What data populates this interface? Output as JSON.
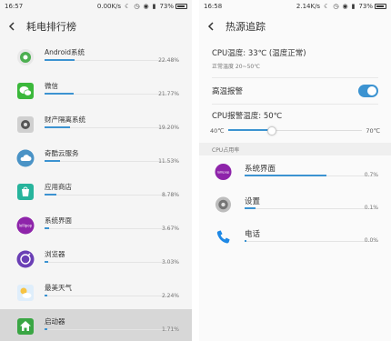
{
  "left": {
    "status": {
      "time": "16:57",
      "net": "0.00K/s",
      "battery": "73%"
    },
    "title": "耗电排行榜",
    "apps": [
      {
        "name": "Android系统",
        "pct": "22.48%",
        "level": 0.2248,
        "icon": "android-system-icon",
        "color": "#4caf50"
      },
      {
        "name": "微信",
        "pct": "21.77%",
        "level": 0.2177,
        "icon": "wechat-icon",
        "color": "#3bb83b"
      },
      {
        "name": "财产隔离系统",
        "pct": "19.20%",
        "level": 0.192,
        "icon": "safe-icon",
        "color": "#d0d0d0"
      },
      {
        "name": "奇酷云服务",
        "pct": "11.53%",
        "level": 0.1153,
        "icon": "cloud-icon",
        "color": "#4a93c6"
      },
      {
        "name": "应用商店",
        "pct": "8.78%",
        "level": 0.0878,
        "icon": "store-icon",
        "color": "#27b49c"
      },
      {
        "name": "系统界面",
        "pct": "3.67%",
        "level": 0.0367,
        "icon": "lollipop-icon",
        "color": "#8e24aa"
      },
      {
        "name": "浏览器",
        "pct": "3.03%",
        "level": 0.0303,
        "icon": "browser-icon",
        "color": "#6a3fb5"
      },
      {
        "name": "最美天气",
        "pct": "2.24%",
        "level": 0.0224,
        "icon": "weather-icon",
        "color": "#5fa8e6"
      },
      {
        "name": "启动器",
        "pct": "1.71%",
        "level": 0.0171,
        "icon": "launcher-icon",
        "color": "#3aa644"
      }
    ]
  },
  "right": {
    "status": {
      "time": "16:58",
      "net": "2.14K/s",
      "battery": "73%"
    },
    "title": "热源追踪",
    "cpu_temp": "CPU温度: 33℃ (温度正常)",
    "normal_range": "正常温度 20~50℃",
    "alarm_label": "高温报警",
    "alarm_on": true,
    "alarm_temp": "CPU报警温度: 50℃",
    "slider_min": "40℃",
    "slider_max": "70℃",
    "slider_level": 0.33,
    "cpu_section": "CPU占用率",
    "cpu_apps": [
      {
        "name": "系统界面",
        "pct": "0.7%",
        "level": 0.72,
        "icon": "lollipop-icon",
        "color": "#8e24aa"
      },
      {
        "name": "设置",
        "pct": "0.1%",
        "level": 0.1,
        "icon": "settings-gear-icon",
        "color": "#9e9e9e"
      },
      {
        "name": "电话",
        "pct": "0.0%",
        "level": 0.02,
        "icon": "phone-icon",
        "color": "#1e88e5"
      }
    ]
  }
}
